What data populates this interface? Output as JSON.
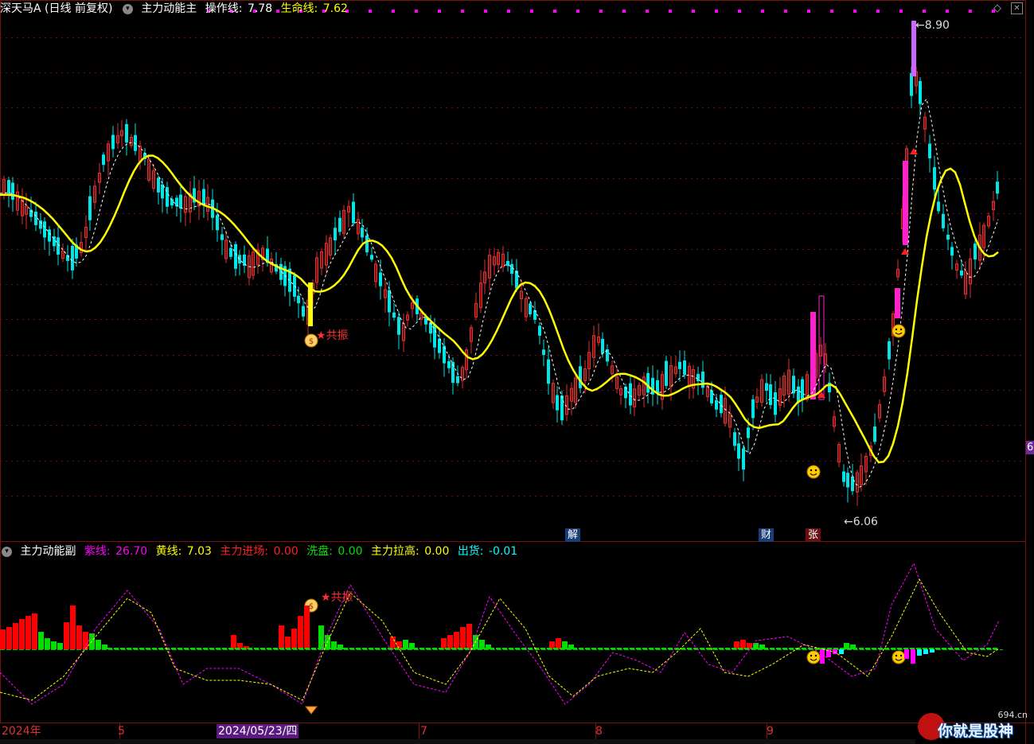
{
  "header_main": {
    "stock_name": "深天马A",
    "period": "(日线 前复权)",
    "indicator": "主力动能主",
    "op_line_label": "操作线:",
    "op_line_value": "7.78",
    "life_line_label": "生命线:",
    "life_line_value": "7.62"
  },
  "header_sub": {
    "indicator": "主力动能副",
    "purple_label": "紫线:",
    "purple_value": "26.70",
    "yellow_label": "黄线:",
    "yellow_value": "7.03",
    "enter_label": "主力进场:",
    "enter_value": "0.00",
    "wash_label": "洗盘:",
    "wash_value": "0.00",
    "pull_label": "主力拉高:",
    "pull_value": "0.00",
    "ship_label": "出货:",
    "ship_value": "-0.01"
  },
  "annotations": {
    "resonance_main": "共振",
    "resonance_sub": "共振",
    "high_price": "8.90",
    "low_price": "6.06",
    "tag_jie": "解",
    "tag_cai": "财",
    "tag_zhang": "张",
    "right_edge": "6"
  },
  "time_axis": {
    "labels": [
      "2024年",
      "5",
      "2024/05/23/四",
      "7",
      "8",
      "9"
    ]
  },
  "watermark": {
    "text": "你就是股神",
    "domain": "694.cn"
  },
  "colors": {
    "up": "#e03030",
    "down": "#00e5e5",
    "life_line": "#ffff00",
    "op_line": "#ffffff",
    "purple": "#ff00ff",
    "sub_green": "#00e000",
    "sub_red": "#ff0000",
    "sub_cyan": "#00ffff",
    "sub_magenta": "#ff00ff"
  },
  "chart_data": {
    "type": "candlestick",
    "price_range": [
      6.0,
      9.0
    ],
    "high": 8.9,
    "low": 6.06,
    "last_op_line": 7.78,
    "last_life_line": 7.62
  }
}
